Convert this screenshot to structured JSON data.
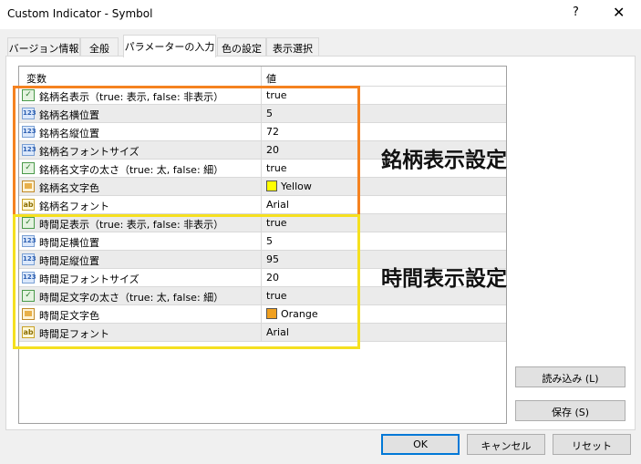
{
  "window": {
    "title": "Custom Indicator - Symbol",
    "help": "?",
    "close": "✕"
  },
  "tabs": [
    {
      "label": "バージョン情報"
    },
    {
      "label": "全般"
    },
    {
      "label": "パラメーターの入力"
    },
    {
      "label": "色の設定"
    },
    {
      "label": "表示選択"
    }
  ],
  "grid": {
    "headers": {
      "variable": "変数",
      "value": "値"
    },
    "rows": [
      {
        "icon": "bool",
        "name": "銘柄名表示（true: 表示, false: 非表示）",
        "value": "true"
      },
      {
        "icon": "int",
        "name": "銘柄名横位置",
        "value": "5"
      },
      {
        "icon": "int",
        "name": "銘柄名縦位置",
        "value": "72"
      },
      {
        "icon": "int",
        "name": "銘柄名フォントサイズ",
        "value": "20"
      },
      {
        "icon": "bool",
        "name": "銘柄名文字の太さ（true: 太, false: 細）",
        "value": "true"
      },
      {
        "icon": "color",
        "name": "銘柄名文字色",
        "value": "Yellow",
        "swatch": "#ffff00"
      },
      {
        "icon": "str",
        "name": "銘柄名フォント",
        "value": "Arial"
      },
      {
        "icon": "bool",
        "name": "時間足表示（true: 表示, false: 非表示）",
        "value": "true"
      },
      {
        "icon": "int",
        "name": "時間足横位置",
        "value": "5"
      },
      {
        "icon": "int",
        "name": "時間足縦位置",
        "value": "95"
      },
      {
        "icon": "int",
        "name": "時間足フォントサイズ",
        "value": "20"
      },
      {
        "icon": "bool",
        "name": "時間足文字の太さ（true: 太, false: 細）",
        "value": "true"
      },
      {
        "icon": "color",
        "name": "時間足文字色",
        "value": "Orange",
        "swatch": "#f0a020"
      },
      {
        "icon": "str",
        "name": "時間足フォント",
        "value": "Arial"
      }
    ]
  },
  "icons": {
    "int": "123",
    "bool": "✓",
    "str": "ab"
  },
  "annotations": {
    "symbol_settings": "銘柄表示設定",
    "timeframe_settings": "時間表示設定"
  },
  "buttons": {
    "load": "読み込み (L)",
    "save": "保存 (S)",
    "ok": "OK",
    "cancel": "キャンセル",
    "reset": "リセット"
  },
  "colors": {
    "orange_box": "#f58220",
    "yellow_box": "#f5e020",
    "accent": "#0078d7"
  }
}
